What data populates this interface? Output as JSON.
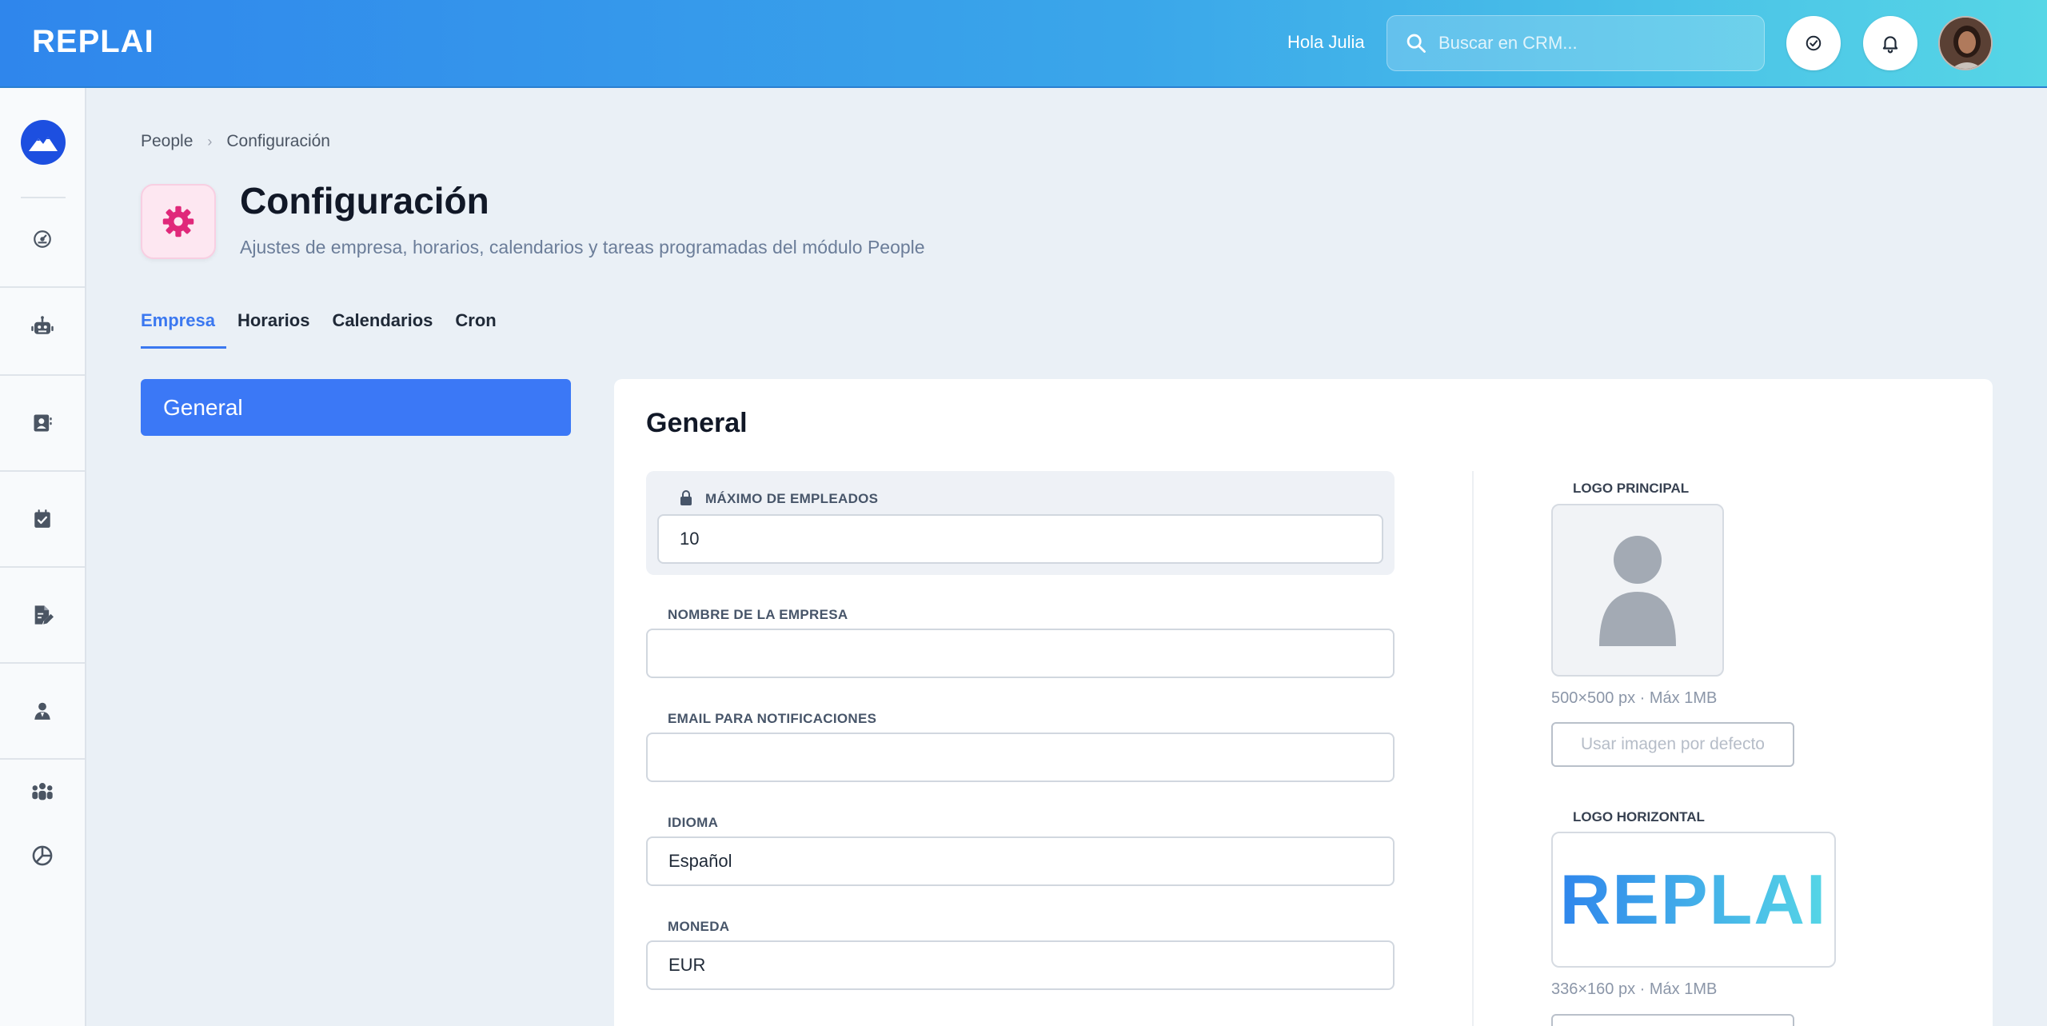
{
  "header": {
    "brand": "REPLAI",
    "greeting": "Hola Julia",
    "search_placeholder": "Buscar en CRM..."
  },
  "sidebar": {
    "items": [
      {
        "icon": "dashboard-icon"
      },
      {
        "icon": "robot-icon"
      },
      {
        "icon": "contacts-icon"
      },
      {
        "icon": "tasks-icon"
      },
      {
        "icon": "document-edit-icon"
      },
      {
        "icon": "person-icon"
      },
      {
        "icon": "team-icon"
      },
      {
        "icon": "pie-chart-icon"
      }
    ]
  },
  "breadcrumb": {
    "root": "People",
    "current": "Configuración"
  },
  "page": {
    "title": "Configuración",
    "subtitle": "Ajustes de empresa, horarios, calendarios y tareas programadas del módulo People"
  },
  "tabs": [
    {
      "label": "Empresa",
      "active": true
    },
    {
      "label": "Horarios",
      "active": false
    },
    {
      "label": "Calendarios",
      "active": false
    },
    {
      "label": "Cron",
      "active": false
    }
  ],
  "sections": {
    "general_label": "General"
  },
  "panel": {
    "title": "General",
    "fields": {
      "max_employees": {
        "label": "MÁXIMO DE EMPLEADOS",
        "value": "10"
      },
      "company_name": {
        "label": "NOMBRE DE LA EMPRESA",
        "value": ""
      },
      "notification_email": {
        "label": "EMAIL PARA NOTIFICACIONES",
        "value": ""
      },
      "language": {
        "label": "IDIOMA",
        "value": "Español"
      },
      "currency": {
        "label": "MONEDA",
        "value": "EUR"
      }
    },
    "logo_main": {
      "label": "LOGO PRINCIPAL",
      "hint": "500×500 px · Máx 1MB",
      "default_button": "Usar imagen por defecto"
    },
    "logo_horizontal": {
      "label": "LOGO HORIZONTAL",
      "image_text": "REPLAI",
      "hint": "336×160 px · Máx 1MB"
    }
  },
  "colors": {
    "accent": "#3b78f6",
    "header_start": "#2f86ec",
    "header_end": "#56d6e6",
    "settings_icon": "#e0287a"
  }
}
